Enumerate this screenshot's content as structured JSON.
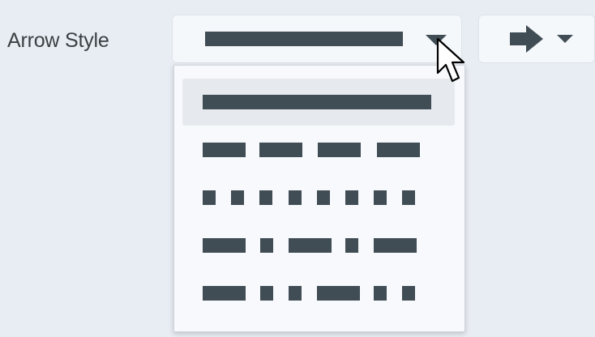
{
  "field": {
    "label": "Arrow Style",
    "selected_style": "solid"
  },
  "head_button": {
    "icon": "arrow-right-icon",
    "menu_icon": "caret-down-icon"
  },
  "menu": {
    "options": [
      {
        "id": "solid",
        "pattern": "solid",
        "selected": true
      },
      {
        "id": "dash",
        "pattern": "long-dash"
      },
      {
        "id": "dot",
        "pattern": "square-dot"
      },
      {
        "id": "dash-dot",
        "pattern": "dash-dot"
      },
      {
        "id": "dash-dot-dot",
        "pattern": "dash-dot-dot"
      }
    ]
  },
  "colors": {
    "background": "#e8edf3",
    "control": "#f5f8fb",
    "stroke": "#414d55",
    "selected_row": "#e6eaee"
  }
}
